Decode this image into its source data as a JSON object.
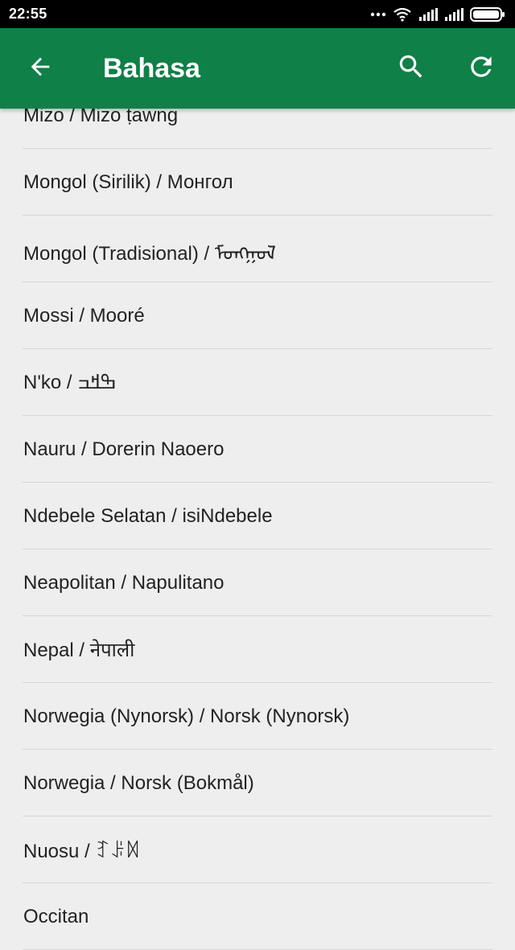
{
  "status_bar": {
    "time": "22:55"
  },
  "app_bar": {
    "title": "Bahasa",
    "background": "#0f8048",
    "icons": {
      "back": "arrow-back-icon",
      "search": "search-icon",
      "refresh": "refresh-icon"
    }
  },
  "languages": [
    "Mizo / Mizo ṭawng",
    "Mongol (Sirilik) / Монгол",
    "Mongol (Tradisional) / ᠮᠣᠩᠭᠣᠯ",
    "Mossi / Mooré",
    "N'ko / ߒߞߏ",
    "Nauru / Dorerin Naoero",
    "Ndebele Selatan / isiNdebele",
    "Neapolitan / Napulitano",
    "Nepal / नेपाली",
    "Norwegia (Nynorsk) / Norsk (Nynorsk)",
    "Norwegia / Norsk (Bokmål)",
    "Nuosu / ꆈꌠꉙ",
    "Occitan"
  ]
}
